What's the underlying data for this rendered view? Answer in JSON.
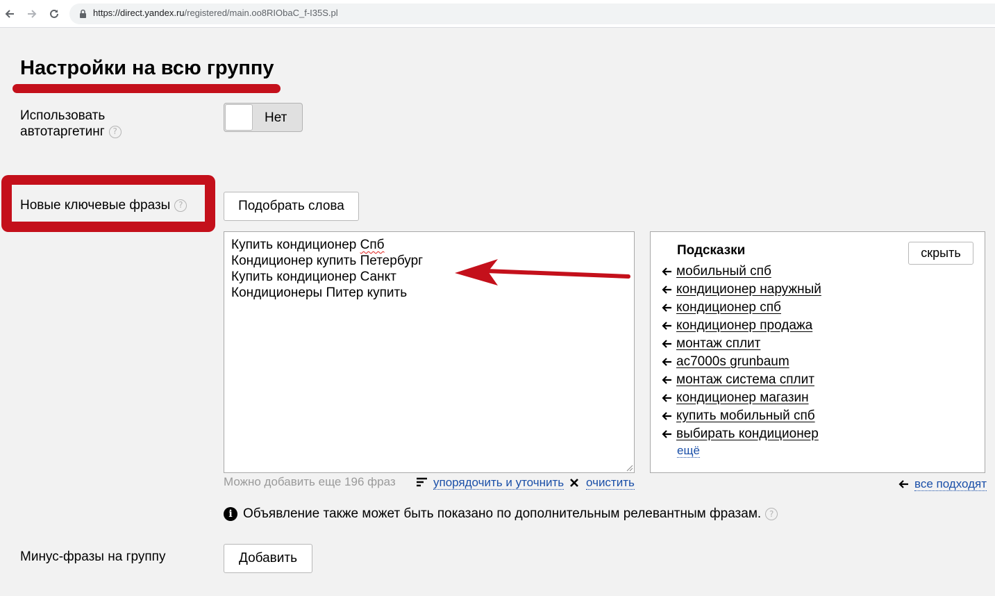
{
  "browser": {
    "url_host": "https://direct.yandex.ru",
    "url_path": "/registered/main.oo8RIObaC_f-I35S.pl"
  },
  "page": {
    "title": "Настройки на всю группу"
  },
  "autotargeting": {
    "label_line1": "Использовать",
    "label_line2": "автотаргетинг",
    "help": "?",
    "toggle_value": "Нет",
    "enabled": false
  },
  "keywords": {
    "label": "Новые ключевые фразы",
    "help": "?",
    "pick_button": "Подобрать слова",
    "phrases": [
      "Купить кондиционер Спб",
      "Кондиционер купить Петербург",
      "Купить кондиционер Санкт",
      "Кондиционеры Питер купить"
    ],
    "phrase1_prefix": "Купить кондиционер ",
    "phrase1_word": "Спб",
    "remaining_note": "Можно добавить еще 196 фраз",
    "sort_link": "упорядочить и уточнить",
    "clear_link": "очистить"
  },
  "hints": {
    "title": "Подсказки",
    "hide_button": "скрыть",
    "items": [
      "мобильный спб",
      "кондиционер наружный",
      "кондиционер спб",
      "кондиционер продажа",
      "монтаж сплит",
      "ac7000s grunbaum",
      "монтаж система сплит",
      "кондиционер магазин",
      "купить мобильный спб",
      "выбирать кондиционер"
    ],
    "more_link": "ещё",
    "all_fit_link": "все подходят"
  },
  "info": {
    "icon": "i",
    "text": "Объявление также может быть показано по дополнительным релевантным фразам.",
    "help": "?"
  },
  "negative": {
    "label": "Минус-фразы на группу",
    "add_button": "Добавить"
  },
  "colors": {
    "annotation_red": "#c4101b",
    "link_blue": "#1a4fa8",
    "background": "#f2f2f2"
  },
  "icons": [
    "back-arrow-icon",
    "forward-arrow-icon",
    "reload-icon",
    "lock-icon",
    "help-icon",
    "left-arrow-icon",
    "sort-icon",
    "close-icon",
    "info-icon",
    "resize-grip-icon"
  ]
}
